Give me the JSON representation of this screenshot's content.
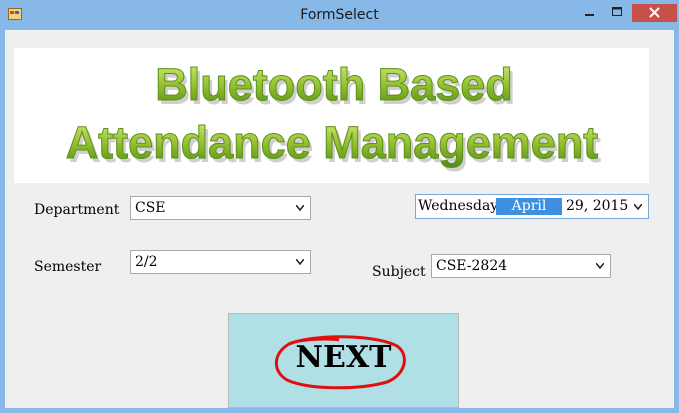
{
  "window": {
    "title": "FormSelect",
    "icons": [
      "app-icon",
      "minimize-icon",
      "maximize-icon",
      "close-icon"
    ]
  },
  "banner": {
    "line1": "Bluetooth Based",
    "line2": "Attendance Management",
    "colors": {
      "text": "#8fbe2c",
      "shadow": "#c8c8c8"
    }
  },
  "form": {
    "department": {
      "label": "Department",
      "value": "CSE"
    },
    "semester": {
      "label": "Semester",
      "value": "2/2"
    },
    "subject": {
      "label": "Subject",
      "value": "CSE-2824"
    },
    "date": {
      "weekday": "Wednesday,",
      "month": "April",
      "rest": "29, 2015"
    },
    "next_label": "NEXT"
  },
  "colors": {
    "titlebar": "#87b8e8",
    "client": "#efefef",
    "next_button": "#b0e0e6",
    "selection": "#3e8fe0",
    "scribble": "#e01010"
  }
}
